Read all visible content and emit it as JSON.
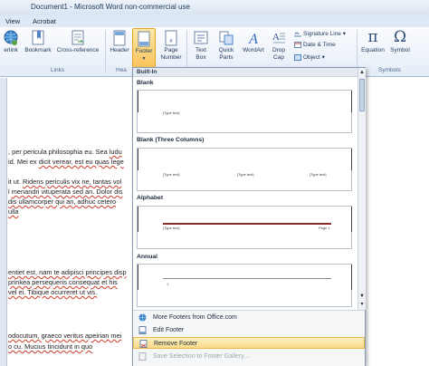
{
  "window": {
    "title": "Document1  -  Microsoft Word non-commercial use"
  },
  "tabs": [
    {
      "label": "View"
    },
    {
      "label": "Acrobat"
    }
  ],
  "ribbon": {
    "links_group": {
      "label": "Links",
      "buttons": [
        {
          "label": "erlink",
          "icon": "globe-link-icon"
        },
        {
          "label": "Bookmark",
          "icon": "bookmark-icon"
        },
        {
          "label": "Cross-reference",
          "icon": "cross-reference-icon"
        }
      ]
    },
    "header_footer_group": {
      "label": "Hea",
      "buttons": [
        {
          "label": "Header",
          "icon": "header-icon"
        },
        {
          "label": "Footer",
          "icon": "footer-icon"
        },
        {
          "label": "Page Number",
          "line1": "Page",
          "line2": "Number",
          "icon": "page-number-icon"
        }
      ]
    },
    "text_group": {
      "buttons": [
        {
          "line1": "Text",
          "line2": "Box",
          "icon": "text-box-icon"
        },
        {
          "line1": "Quick",
          "line2": "Parts",
          "icon": "quick-parts-icon"
        },
        {
          "label": "WordArt",
          "icon": "wordart-icon"
        },
        {
          "line1": "Drop",
          "line2": "Cap",
          "icon": "drop-cap-icon"
        }
      ],
      "small": [
        {
          "label": "Signature Line",
          "icon": "signature-icon"
        },
        {
          "label": "Date & Time",
          "icon": "date-time-icon"
        },
        {
          "label": "Object",
          "icon": "object-icon"
        }
      ]
    },
    "symbols_group": {
      "label": "Symbols",
      "buttons": [
        {
          "label": "Equation",
          "glyph": "π",
          "icon": "equation-icon"
        },
        {
          "label": "Symbol",
          "glyph": "Ω",
          "icon": "symbol-icon"
        }
      ]
    }
  },
  "document": {
    "lines": [
      {
        "pre": ", per pericula philosophia eu. Sea ",
        "err": "ludu",
        "post": ""
      },
      {
        "pre": " id. Mei ex ",
        "err": "dicit verear, est eu quas lege",
        "post": ""
      },
      {
        "pre": "",
        "err": "",
        "post": ""
      },
      {
        "pre": "it ut. ",
        "err": "Ridens periculis vix ne, tantas vol",
        "post": ""
      },
      {
        "pre": "l ",
        "err": "menandri vituperata sed an. Dolor dis",
        "post": ""
      },
      {
        "pre": "",
        "err": "dis ullamcorper qui an, adhuc cetero",
        "post": ""
      },
      {
        "pre": " ",
        "err": "ulla",
        "post": ""
      },
      {
        "pre": "",
        "err": "entiet est, nam te adipisci principes disp",
        "post": ""
      },
      {
        "pre": "",
        "err": "prinkea persequeris consequat et his",
        "post": ""
      },
      {
        "pre": "",
        "err": "vel ei. Tibique ocurreret ut vis.",
        "post": ""
      },
      {
        "pre": "",
        "err": "",
        "post": ""
      },
      {
        "pre": "",
        "err": "odocutum, graeco veritus apeirian mei",
        "post": ""
      },
      {
        "pre": "",
        "err": "o cu. Mucius tincidunt in quo",
        "post": ""
      }
    ]
  },
  "gallery": {
    "header": "Built-In",
    "sections": [
      {
        "title": "Blank",
        "tags": [
          "[Type text]"
        ],
        "layout": "center"
      },
      {
        "title": "Blank (Three Columns)",
        "tags": [
          "[Type text]",
          "[Type text]",
          "[Type text]"
        ],
        "layout": "three"
      },
      {
        "title": "Alphabet",
        "tags": [
          "[Type text]",
          "Page 1"
        ],
        "layout": "alphabet"
      },
      {
        "title": "Annual",
        "tags": [
          "1"
        ],
        "layout": "annual"
      }
    ],
    "menu": [
      {
        "label": "More Footers from Office.com",
        "underline": "M",
        "icon": "office-com-icon",
        "state": "normal"
      },
      {
        "label": "Edit Footer",
        "underline": "E",
        "icon": "edit-footer-icon",
        "state": "normal"
      },
      {
        "label": "Remove Footer",
        "underline": "R",
        "icon": "remove-footer-icon",
        "state": "hover"
      },
      {
        "label": "Save Selection to Footer Gallery...",
        "underline": "S",
        "icon": "save-selection-icon",
        "state": "disabled"
      }
    ]
  }
}
